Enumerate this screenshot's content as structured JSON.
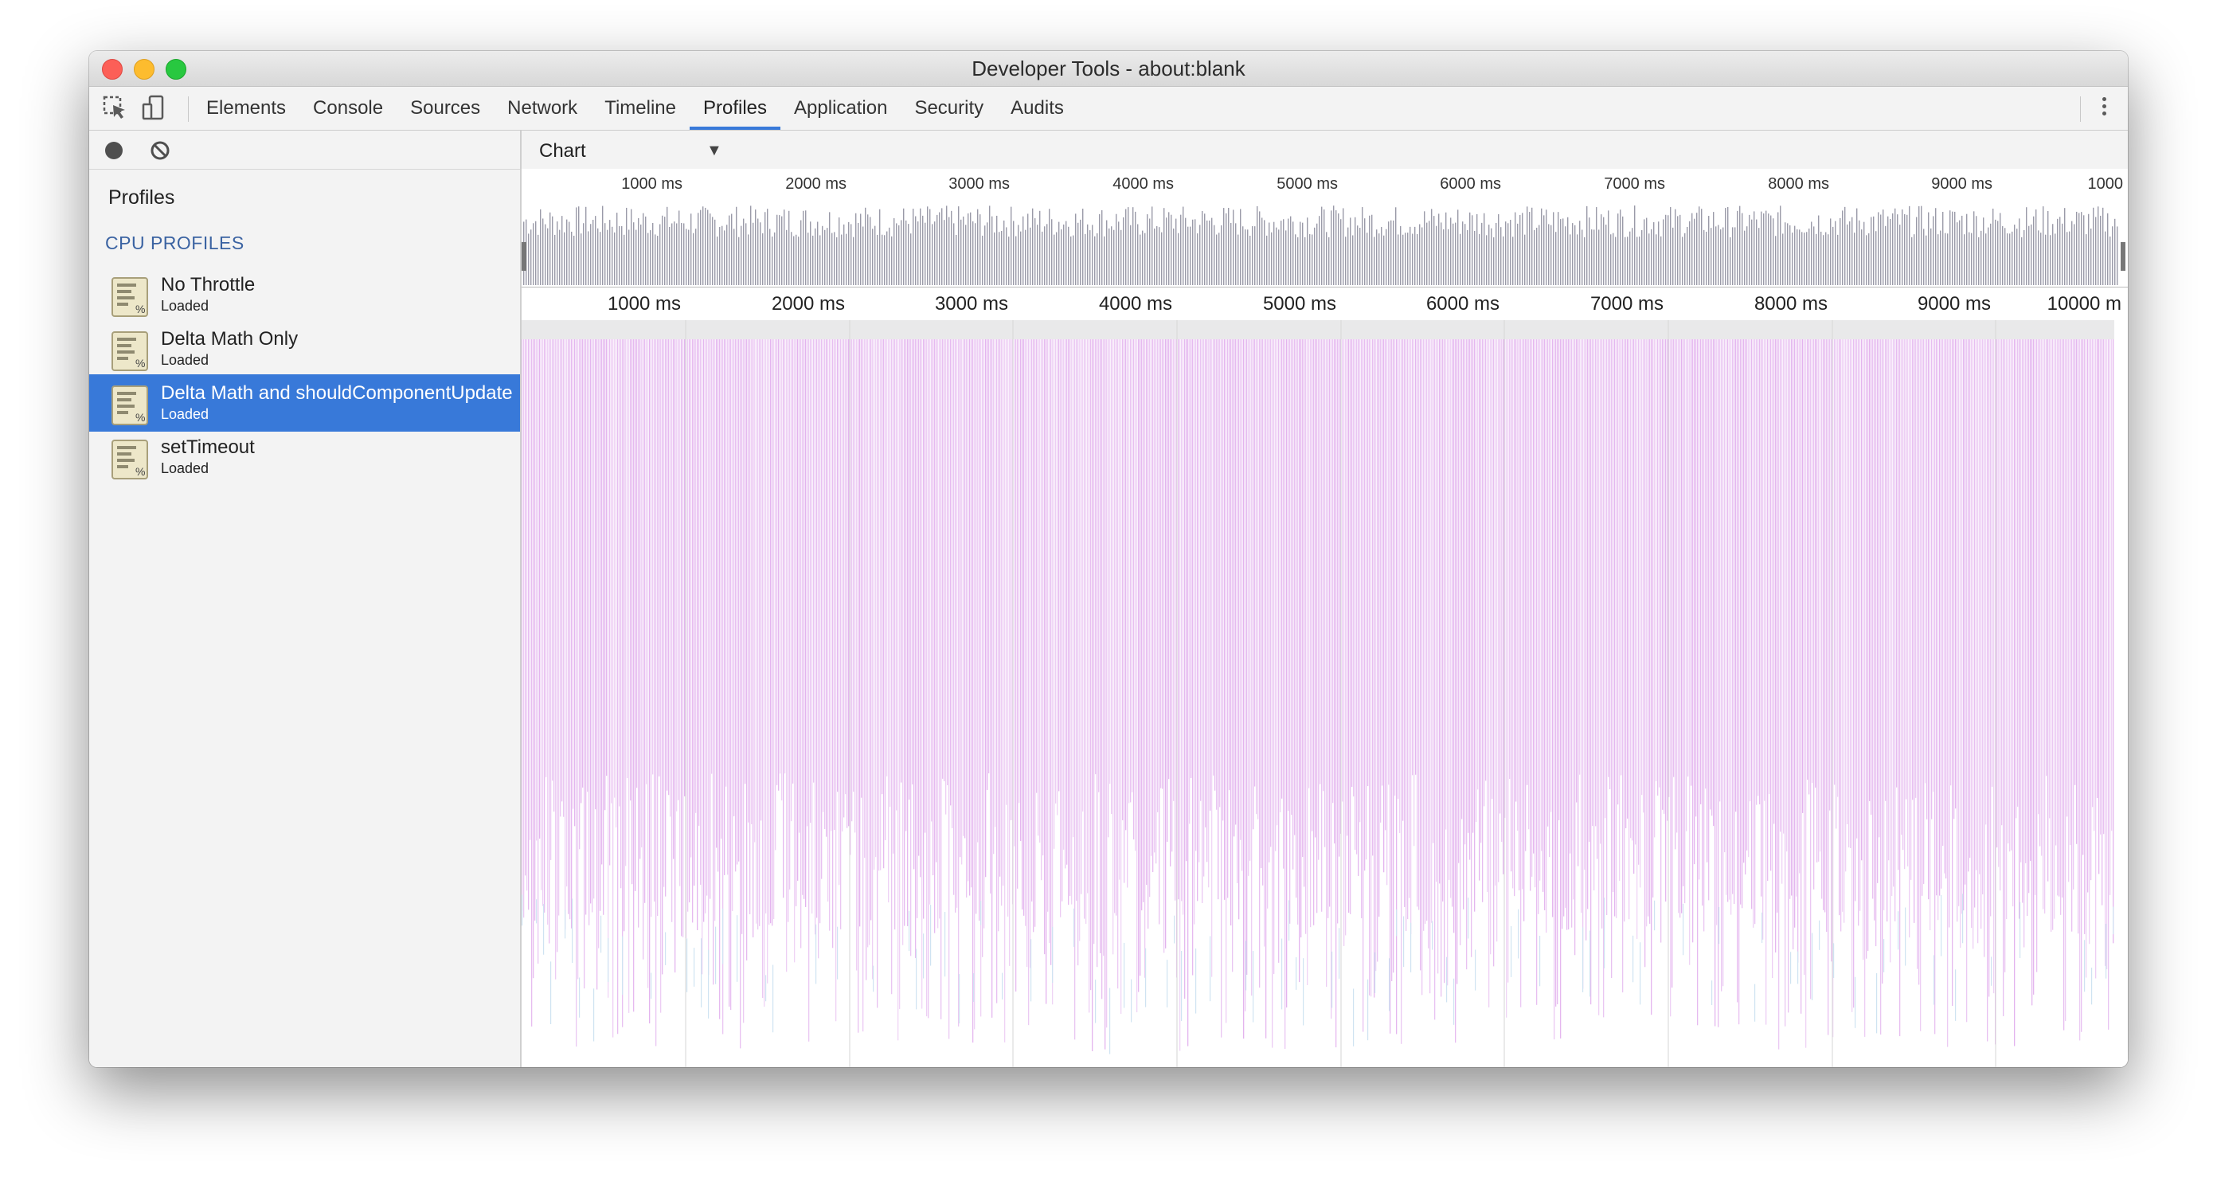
{
  "window": {
    "title": "Developer Tools - about:blank"
  },
  "toolbar": {
    "icons": [
      "inspect-element-icon",
      "device-mode-icon",
      "more-options-icon"
    ],
    "tabs": [
      {
        "label": "Elements",
        "active": false
      },
      {
        "label": "Console",
        "active": false
      },
      {
        "label": "Sources",
        "active": false
      },
      {
        "label": "Network",
        "active": false
      },
      {
        "label": "Timeline",
        "active": false
      },
      {
        "label": "Profiles",
        "active": true
      },
      {
        "label": "Application",
        "active": false
      },
      {
        "label": "Security",
        "active": false
      },
      {
        "label": "Audits",
        "active": false
      }
    ],
    "accent_color": "#3879d9"
  },
  "sidebar": {
    "title": "Profiles",
    "section_header": "CPU PROFILES",
    "items": [
      {
        "name": "No Throttle",
        "status": "Loaded",
        "selected": false
      },
      {
        "name": "Delta Math Only",
        "status": "Loaded",
        "selected": false
      },
      {
        "name": "Delta Math and shouldComponentUpdate",
        "status": "Loaded",
        "selected": true
      },
      {
        "name": "setTimeout",
        "status": "Loaded",
        "selected": false
      }
    ]
  },
  "main": {
    "view_select": {
      "value": "Chart"
    },
    "overview_ticks": [
      "1000 ms",
      "2000 ms",
      "3000 ms",
      "4000 ms",
      "5000 ms",
      "6000 ms",
      "7000 ms",
      "8000 ms",
      "9000 ms",
      "1000"
    ],
    "flame_ticks": [
      "1000 ms",
      "2000 ms",
      "3000 ms",
      "4000 ms",
      "5000 ms",
      "6000 ms",
      "7000 ms",
      "8000 ms",
      "9000 ms",
      "10000 m"
    ],
    "colors": {
      "overview_bar": "#9a9aa8",
      "flame_primary": "#e3b3ee",
      "flame_secondary": "#cfe3f2",
      "flame_top": "#e9e9ea"
    }
  }
}
